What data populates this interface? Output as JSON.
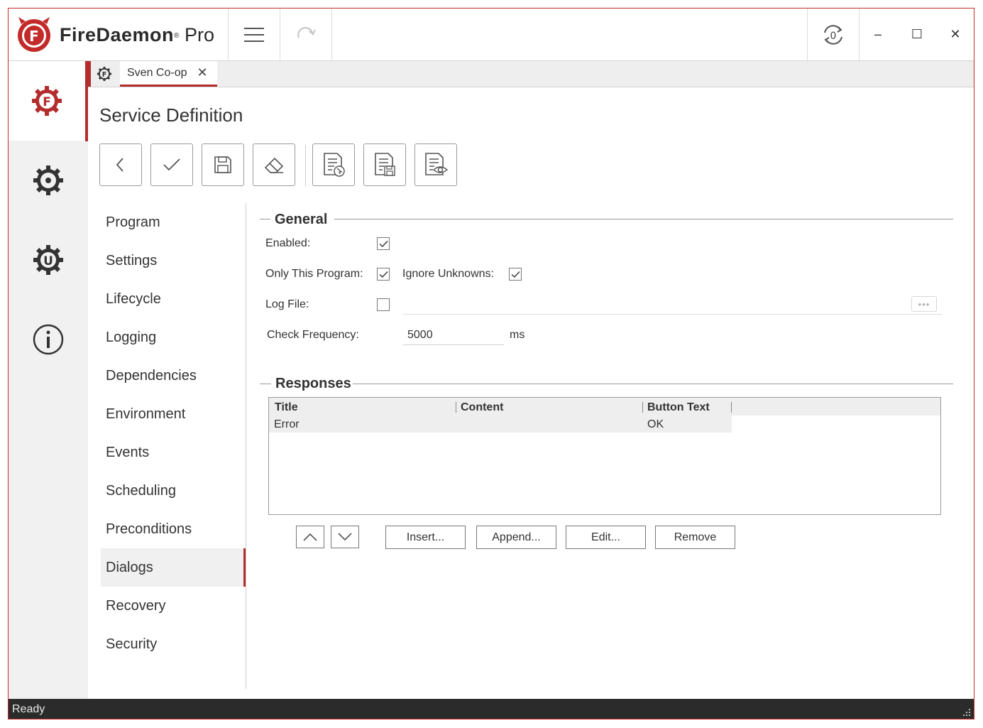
{
  "app": {
    "brand_name": "FireDaemon",
    "brand_suffix": "Pro",
    "brand_reg": "®",
    "accent_color": "#b32d2d"
  },
  "titlebar": {
    "menu_icon": "hamburger-menu-icon",
    "refresh_icon": "refresh-icon",
    "session0_icon": "session-zero-icon",
    "minimize_glyph": "–",
    "maximize_glyph": "☐",
    "close_glyph": "✕"
  },
  "leftbar": {
    "items": [
      {
        "name": "services",
        "icon": "firedaemon-gear-icon"
      },
      {
        "name": "settings",
        "icon": "gear-icon"
      },
      {
        "name": "updates",
        "icon": "update-gear-icon"
      },
      {
        "name": "about",
        "icon": "info-icon"
      }
    ]
  },
  "tabs": {
    "home_icon": "firedaemon-gear-icon",
    "open_tab": "Sven Co-op",
    "close_glyph": "✕"
  },
  "page": {
    "title": "Service Definition"
  },
  "toolbar": {
    "buttons": [
      {
        "name": "back",
        "icon": "chevron-left-icon"
      },
      {
        "name": "apply",
        "icon": "check-icon"
      },
      {
        "name": "save",
        "icon": "floppy-icon"
      },
      {
        "name": "clear",
        "icon": "eraser-icon"
      },
      {
        "name": "import",
        "icon": "document-cursor-icon"
      },
      {
        "name": "export",
        "icon": "document-save-icon"
      },
      {
        "name": "preview",
        "icon": "document-eye-icon"
      }
    ]
  },
  "nav": {
    "items": [
      "Program",
      "Settings",
      "Lifecycle",
      "Logging",
      "Dependencies",
      "Environment",
      "Events",
      "Scheduling",
      "Preconditions",
      "Dialogs",
      "Recovery",
      "Security"
    ],
    "active": "Dialogs"
  },
  "general": {
    "title": "General",
    "enabled_label": "Enabled:",
    "enabled": true,
    "only_this_program_label": "Only This Program:",
    "only_this_program": true,
    "ignore_unknowns_label": "Ignore Unknowns:",
    "ignore_unknowns": true,
    "log_file_label": "Log File:",
    "log_file": false,
    "browse_glyph": "•••",
    "check_frequency_label": "Check Frequency:",
    "check_frequency_value": "5000",
    "check_frequency_unit": "ms"
  },
  "responses": {
    "title": "Responses",
    "columns": [
      "Title",
      "Content",
      "Button Text"
    ],
    "rows": [
      {
        "title": "Error",
        "content": "",
        "button_text": "OK"
      }
    ],
    "move_up_icon": "chevron-up-icon",
    "move_down_icon": "chevron-down-icon",
    "insert_label": "Insert...",
    "append_label": "Append...",
    "edit_label": "Edit...",
    "remove_label": "Remove"
  },
  "status": {
    "text": "Ready"
  }
}
